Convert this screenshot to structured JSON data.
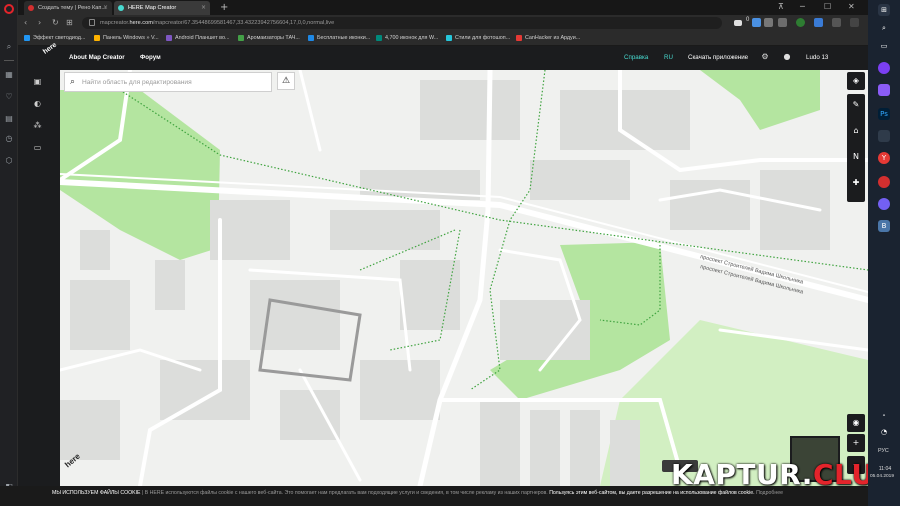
{
  "browser": {
    "tabs": [
      {
        "title": "Создать тему | Рено Кап...",
        "active": false,
        "favicon_color": "#d32f2f"
      },
      {
        "title": "HERE Map Creator",
        "active": true,
        "favicon_color": "#48dad0"
      }
    ],
    "url": {
      "prefix": "mapcreator.",
      "domain": "here.com",
      "rest": "/mapcreator/67.35448699581467,33.43223942756604,17,0,0,normal,live"
    },
    "badge_count": "0",
    "bookmarks": [
      {
        "label": "Эффект светодиод...",
        "color": "#2196f3"
      },
      {
        "label": "Панель Windows » V...",
        "color": "#ffb300"
      },
      {
        "label": "Android Планшет во...",
        "color": "#7e57c2"
      },
      {
        "label": "Аромаизаторы ТАЧ...",
        "color": "#43a047"
      },
      {
        "label": "Бесплатные иконки...",
        "color": "#1e88e5"
      },
      {
        "label": "4,700 иконок для W...",
        "color": "#00897b"
      },
      {
        "label": "Стили для фотошоп...",
        "color": "#26c6da"
      },
      {
        "label": "CanHacker из Ардуи...",
        "color": "#e53935"
      }
    ]
  },
  "app": {
    "logo": "here",
    "nav": [
      "About Map Creator",
      "Форум"
    ],
    "help": "Справка",
    "language": "RU",
    "download": "Скачать приложение",
    "user": "Ludo 13",
    "search_placeholder": "Найти область для редактирования",
    "map_labels": [
      {
        "text": "проспект Строителей Вадима Школьника",
        "id": "street-1"
      },
      {
        "text": "проспект Строителей Вадима Школьника",
        "id": "street-2"
      }
    ]
  },
  "cookie_bar": {
    "title": "МЫ ИСПОЛЬЗУЕМ ФАЙЛЫ COOKIE",
    "text": "| В HERE используются файлы cookie с нашего веб-сайта. Это помогает нам предлагать вам подходящие услуги и сведения, в том числе рекламу из наших партнеров.",
    "accept": "Пользуясь этим веб-сайтом, вы даете разрешение на использование файлов cookie.",
    "more": "Подробнее"
  },
  "watermark": {
    "main": "KAPTUR.",
    "accent": "CLUB",
    "accent_color": "#e3242b"
  },
  "taskbar": {
    "language": "РУС",
    "time": "11:04",
    "date": "05.04.2019"
  },
  "colors": {
    "map_bg": "#f0f1ef",
    "block": "#dfe0de",
    "park": "#b4e5a0",
    "park_light": "#d2efc2",
    "trail": "#3fa33f",
    "accent": "#48dad0"
  }
}
